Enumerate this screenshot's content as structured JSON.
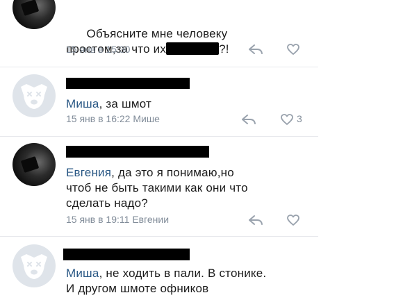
{
  "comments": [
    {
      "line1": "Объясните мне человеку",
      "line2_before": "простом,за что их",
      "line2_after": "?!",
      "meta": "15 янв в 15:30"
    },
    {
      "name": "Миша",
      "text": ", за шмот",
      "meta": "15 янв в 16:22 Мише",
      "likes": "3"
    },
    {
      "name": "Евгения",
      "line1": ", да это я понимаю,но",
      "line2": "чтоб не быть такими как они что",
      "line3": "сделать надо?",
      "meta": "15 янв в 19:11 Евгении"
    },
    {
      "name": "Миша",
      "line1": ", не ходить в пали. В стонике.",
      "line2": "И другом шмоте офников"
    }
  ],
  "colors": {
    "link_name": "#2a5885",
    "meta_gray": "#818c99",
    "icon_gray": "#99a2ad",
    "divider": "#e7e8ec"
  }
}
